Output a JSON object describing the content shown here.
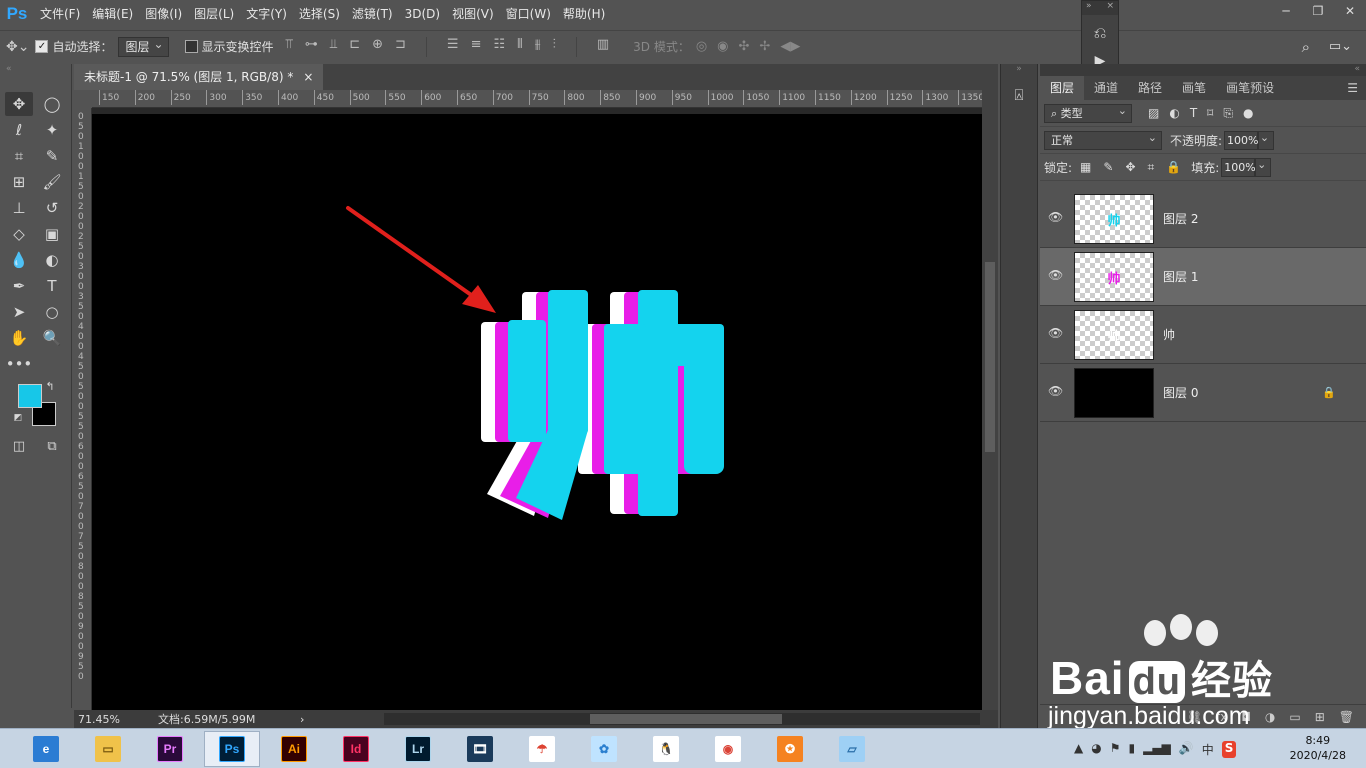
{
  "app": {
    "logo": "Ps",
    "menu": [
      "文件(F)",
      "编辑(E)",
      "图像(I)",
      "图层(L)",
      "文字(Y)",
      "选择(S)",
      "滤镜(T)",
      "3D(D)",
      "视图(V)",
      "窗口(W)",
      "帮助(H)"
    ],
    "window_controls": [
      "─",
      "❐",
      "✕"
    ]
  },
  "options_bar": {
    "auto_select_label": "自动选择：",
    "auto_select_checked": true,
    "auto_select_target": "图层",
    "show_transform_label": "显示变换控件",
    "show_transform_checked": false,
    "mode_3d_label": "3D 模式："
  },
  "document": {
    "tab_title": "未标题-1 @ 71.5% (图层 1, RGB/8) *",
    "close": "×",
    "ruler_ticks": [
      "150",
      "200",
      "250",
      "300",
      "350",
      "400",
      "450",
      "500",
      "550",
      "600",
      "650",
      "700",
      "750",
      "800",
      "850",
      "900",
      "950",
      "1000",
      "1050",
      "1100",
      "1150",
      "1200",
      "1250",
      "1300",
      "1350"
    ],
    "canvas_text": "帅",
    "colors": {
      "cyan": "#14d3ee",
      "magenta": "#e81ee8",
      "white": "#ffffff",
      "arrow": "#e0201c",
      "canvas": "#000000"
    }
  },
  "status": {
    "zoom": "71.45%",
    "doc_size": "文档:6.59M/5.99M"
  },
  "tools": {
    "foreground_color": "#17c7e8",
    "background_color": "#000000"
  },
  "layers_panel": {
    "tabs": [
      "图层",
      "通道",
      "路径",
      "画笔",
      "画笔预设"
    ],
    "filter_type": "类型",
    "blend_mode": "正常",
    "opacity_label": "不透明度:",
    "opacity_value": "100%",
    "lock_label": "锁定:",
    "fill_label": "填充:",
    "fill_value": "100%",
    "layers": [
      {
        "name": "图层 2",
        "thumb_char": "帅",
        "thumb_color": "#14d3ee",
        "selected": false,
        "locked": false
      },
      {
        "name": "图层 1",
        "thumb_char": "帅",
        "thumb_color": "#e81ee8",
        "selected": true,
        "locked": false
      },
      {
        "name": "帅",
        "thumb_char": "帅",
        "thumb_color": "#ffffff",
        "selected": false,
        "locked": false
      },
      {
        "name": "图层 0",
        "thumb_char": "",
        "thumb_color": "#000000",
        "selected": false,
        "locked": true
      }
    ]
  },
  "taskbar": {
    "apps": [
      {
        "name": "browser",
        "label": ""
      },
      {
        "name": "file-explorer",
        "label": ""
      },
      {
        "name": "premiere",
        "label": "Pr"
      },
      {
        "name": "photoshop",
        "label": "Ps"
      },
      {
        "name": "illustrator",
        "label": "Ai"
      },
      {
        "name": "indesign",
        "label": "Id"
      },
      {
        "name": "lightroom",
        "label": "Lr"
      },
      {
        "name": "video-editor",
        "label": ""
      },
      {
        "name": "app-umbrella",
        "label": ""
      },
      {
        "name": "app-bird",
        "label": ""
      },
      {
        "name": "qq",
        "label": ""
      },
      {
        "name": "chrome",
        "label": ""
      },
      {
        "name": "app-orange",
        "label": ""
      },
      {
        "name": "app-notes",
        "label": ""
      }
    ],
    "tray_ime": "中",
    "time": "8:49",
    "date": "2020/4/28"
  },
  "watermark": {
    "brand": "Bai",
    "brand2": "du",
    "brand_cn": "经验",
    "url": "jingyan.baidu.com"
  }
}
